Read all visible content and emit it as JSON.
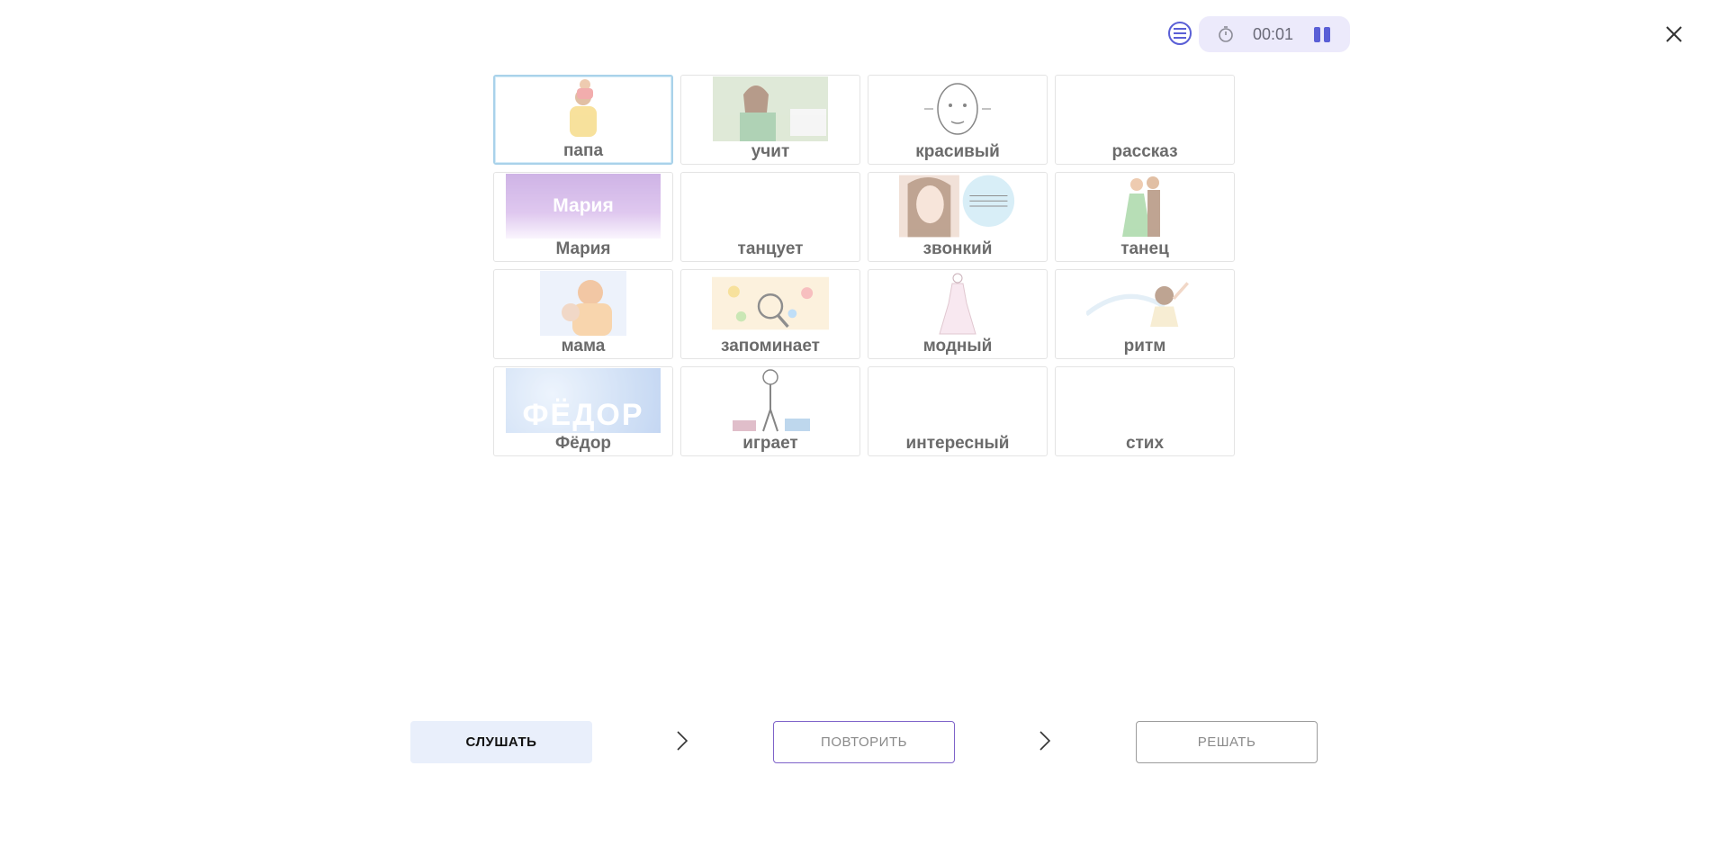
{
  "header": {
    "timer": "00:01",
    "menu_icon": "list-icon",
    "timer_icon": "stopwatch-icon",
    "pause_icon": "pause-icon",
    "close_icon": "close-icon",
    "accent_color": "#5a5fd6"
  },
  "cards": [
    {
      "word": "папа",
      "image": "father-carrying-child"
    },
    {
      "word": "учит",
      "image": "woman-studying-books"
    },
    {
      "word": "красивый",
      "image": "face-sketch"
    },
    {
      "word": "рассказ",
      "image": ""
    },
    {
      "word": "Мария",
      "image": "name-banner",
      "image_text": "Мария"
    },
    {
      "word": "танцует",
      "image": ""
    },
    {
      "word": "звонкий",
      "image": "singing-woman"
    },
    {
      "word": "танец",
      "image": "dancing-couple"
    },
    {
      "word": "мама",
      "image": "mother-hugging-child"
    },
    {
      "word": "запоминает",
      "image": "magnifier-ideas"
    },
    {
      "word": "модный",
      "image": "fashion-dress-sketch"
    },
    {
      "word": "ритм",
      "image": "dancing-girl"
    },
    {
      "word": "Фёдор",
      "image": "name-banner",
      "image_text": "ФЁДОР"
    },
    {
      "word": "играет",
      "image": "stick-figure-with-toys"
    },
    {
      "word": "интересный",
      "image": ""
    },
    {
      "word": "стих",
      "image": ""
    }
  ],
  "buttons": {
    "listen": "СЛУШАТЬ",
    "repeat": "ПОВТОРИТЬ",
    "solve": "РЕШАТЬ"
  }
}
